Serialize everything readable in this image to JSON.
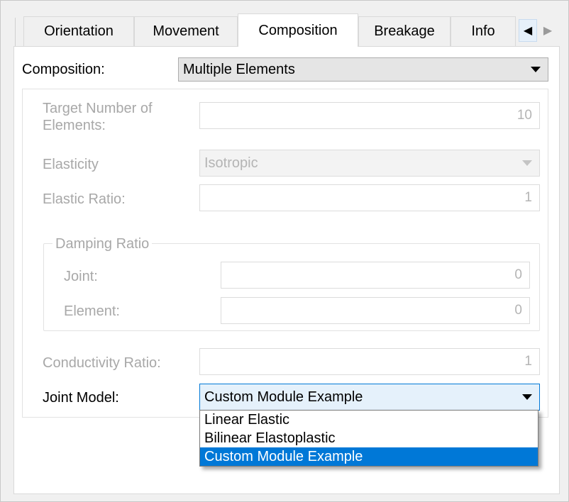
{
  "tabs": [
    {
      "label": "Orientation",
      "active": false
    },
    {
      "label": "Movement",
      "active": false
    },
    {
      "label": "Composition",
      "active": true
    },
    {
      "label": "Breakage",
      "active": false
    },
    {
      "label": "Info",
      "active": false
    }
  ],
  "tab_scroll": {
    "left_glyph": "◀",
    "right_glyph": "▶"
  },
  "composition": {
    "label": "Composition:",
    "value": "Multiple Elements"
  },
  "target_elements": {
    "label": "Target Number of Elements:",
    "value": "10"
  },
  "elasticity": {
    "label": "Elasticity",
    "value": "Isotropic"
  },
  "elastic_ratio": {
    "label": "Elastic Ratio:",
    "value": "1"
  },
  "damping": {
    "title": "Damping Ratio",
    "joint": {
      "label": "Joint:",
      "value": "0"
    },
    "element": {
      "label": "Element:",
      "value": "0"
    }
  },
  "conductivity": {
    "label": "Conductivity Ratio:",
    "value": "1"
  },
  "joint_model": {
    "label": "Joint Model:",
    "value": "Custom Module Example",
    "options": [
      "Linear Elastic",
      "Bilinear Elastoplastic",
      "Custom Module Example"
    ],
    "selected_index": 2
  },
  "colors": {
    "selection": "#0078d7",
    "focus_border": "#0078d7",
    "combo_bg": "#e5e5e5",
    "disabled_text": "#a8a8a8"
  }
}
